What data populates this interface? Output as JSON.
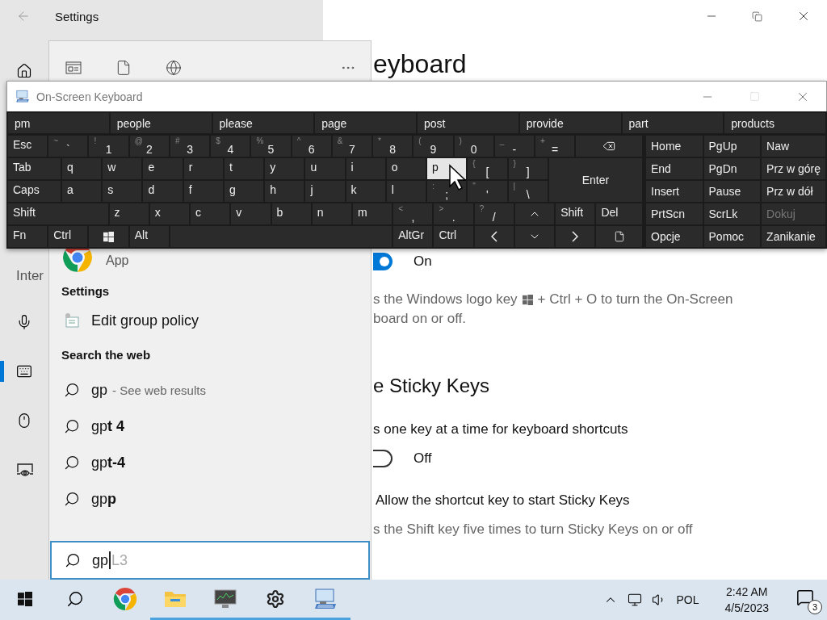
{
  "settings_window": {
    "title": "Settings",
    "nav_section": "Inter",
    "nav_items": [
      {
        "kind": "microphone",
        "selected": false
      },
      {
        "kind": "keyboard",
        "selected": true
      },
      {
        "kind": "mouse",
        "selected": false
      },
      {
        "kind": "eye",
        "selected": false
      }
    ],
    "heading": "eyboard",
    "osk_toggle": {
      "on": true,
      "label": "On"
    },
    "osk_hint": {
      "before": "s the Windows logo key",
      "after": "+ Ctrl + O to turn the On-Screen",
      "line2": "board on or off."
    },
    "sticky_heading": "e Sticky Keys",
    "sticky_desc": "s one key at a time for keyboard shortcuts",
    "sticky_toggle": {
      "on": false,
      "label": "Off"
    },
    "sticky_shortcut_label": "Allow the shortcut key to start Sticky Keys",
    "sticky_shortcut_hint": "s the Shift key five times to turn Sticky Keys on or off"
  },
  "search_panel": {
    "app_caption": "App",
    "settings_header": "Settings",
    "settings_items": [
      {
        "label": "Edit group policy"
      }
    ],
    "web_header": "Search the web",
    "web_results": [
      {
        "text": "gp",
        "suffix": "- See web results"
      },
      {
        "text": "gp**t 4**"
      },
      {
        "text": "gp**t-4**"
      },
      {
        "text": "gp**p**"
      }
    ],
    "query": {
      "value": "gp",
      "suggestion": "L3"
    }
  },
  "osk": {
    "title": "On-Screen Keyboard",
    "predictions": [
      "pm",
      "people",
      "please",
      "page",
      "post",
      "provide",
      "part",
      "products"
    ],
    "rows": [
      [
        {
          "kind": "text",
          "label": "Esc",
          "pressed": false
        },
        {
          "kind": "symbol",
          "label": "`",
          "shift": "~",
          "pressed": false
        },
        {
          "kind": "symbol",
          "label": "1",
          "shift": "!",
          "pressed": false
        },
        {
          "kind": "symbol",
          "label": "2",
          "shift": "@",
          "pressed": false
        },
        {
          "kind": "symbol",
          "label": "3",
          "shift": "#",
          "pressed": false
        },
        {
          "kind": "symbol",
          "label": "4",
          "shift": "$",
          "pressed": false
        },
        {
          "kind": "symbol",
          "label": "5",
          "shift": "%",
          "pressed": false
        },
        {
          "kind": "symbol",
          "label": "6",
          "shift": "^",
          "pressed": false
        },
        {
          "kind": "symbol",
          "label": "7",
          "shift": "&",
          "pressed": false
        },
        {
          "kind": "symbol",
          "label": "8",
          "shift": "*",
          "pressed": false
        },
        {
          "kind": "symbol",
          "label": "9",
          "shift": "(",
          "pressed": false
        },
        {
          "kind": "symbol",
          "label": "0",
          "shift": ")",
          "pressed": false
        },
        {
          "kind": "symbol",
          "label": "-",
          "shift": "_",
          "pressed": false
        },
        {
          "kind": "symbol",
          "label": "=",
          "shift": "+",
          "pressed": false
        },
        {
          "kind": "backspace",
          "pressed": false
        }
      ],
      [
        {
          "kind": "text",
          "label": "Tab",
          "pressed": false
        },
        {
          "kind": "text",
          "label": "q",
          "pressed": false
        },
        {
          "kind": "text",
          "label": "w",
          "pressed": false
        },
        {
          "kind": "text",
          "label": "e",
          "pressed": false
        },
        {
          "kind": "text",
          "label": "r",
          "pressed": false
        },
        {
          "kind": "text",
          "label": "t",
          "pressed": false
        },
        {
          "kind": "text",
          "label": "y",
          "pressed": false
        },
        {
          "kind": "text",
          "label": "u",
          "pressed": false
        },
        {
          "kind": "text",
          "label": "i",
          "pressed": false
        },
        {
          "kind": "text",
          "label": "o",
          "pressed": false
        },
        {
          "kind": "text",
          "label": "p",
          "pressed": true
        },
        {
          "kind": "symbol",
          "label": "[",
          "shift": "{",
          "pressed": false
        },
        {
          "kind": "symbol",
          "label": "]",
          "shift": "}",
          "pressed": false
        },
        {
          "kind": "enter",
          "label": "Enter",
          "pressed": false
        }
      ],
      [
        {
          "kind": "text",
          "label": "Caps",
          "pressed": false
        },
        {
          "kind": "text",
          "label": "a",
          "pressed": false
        },
        {
          "kind": "text",
          "label": "s",
          "pressed": false
        },
        {
          "kind": "text",
          "label": "d",
          "pressed": false
        },
        {
          "kind": "text",
          "label": "f",
          "pressed": false
        },
        {
          "kind": "text",
          "label": "g",
          "pressed": false
        },
        {
          "kind": "text",
          "label": "h",
          "pressed": false
        },
        {
          "kind": "text",
          "label": "j",
          "pressed": false
        },
        {
          "kind": "text",
          "label": "k",
          "pressed": false
        },
        {
          "kind": "text",
          "label": "l",
          "pressed": false
        },
        {
          "kind": "symbol",
          "label": ";",
          "shift": ":",
          "pressed": false
        },
        {
          "kind": "symbol",
          "label": "'",
          "shift": "\"",
          "pressed": false
        },
        {
          "kind": "symbol",
          "label": "\\",
          "shift": "|",
          "pressed": false
        }
      ],
      [
        {
          "kind": "text",
          "label": "Shift",
          "pressed": false
        },
        {
          "kind": "text",
          "label": "z",
          "pressed": false
        },
        {
          "kind": "text",
          "label": "x",
          "pressed": false
        },
        {
          "kind": "text",
          "label": "c",
          "pressed": false
        },
        {
          "kind": "text",
          "label": "v",
          "pressed": false
        },
        {
          "kind": "text",
          "label": "b",
          "pressed": false
        },
        {
          "kind": "text",
          "label": "n",
          "pressed": false
        },
        {
          "kind": "text",
          "label": "m",
          "pressed": false
        },
        {
          "kind": "symbol",
          "label": ",",
          "shift": "<",
          "pressed": false
        },
        {
          "kind": "symbol",
          "label": ".",
          "shift": ">",
          "pressed": false
        },
        {
          "kind": "symbol",
          "label": "/",
          "shift": "?",
          "pressed": false
        },
        {
          "kind": "up",
          "pressed": false
        },
        {
          "kind": "text",
          "label": "Shift",
          "pressed": false
        },
        {
          "kind": "text",
          "label": "Del",
          "pressed": false
        }
      ],
      [
        {
          "kind": "text",
          "label": "Fn",
          "pressed": false
        },
        {
          "kind": "text",
          "label": "Ctrl",
          "pressed": false
        },
        {
          "kind": "windows",
          "pressed": false
        },
        {
          "kind": "text",
          "label": "Alt",
          "pressed": false
        },
        {
          "kind": "space",
          "pressed": false
        },
        {
          "kind": "text",
          "label": "AltGr",
          "pressed": false
        },
        {
          "kind": "text",
          "label": "Ctrl",
          "pressed": false
        },
        {
          "kind": "left",
          "pressed": false
        },
        {
          "kind": "down",
          "pressed": false
        },
        {
          "kind": "right",
          "pressed": false
        },
        {
          "kind": "menu",
          "pressed": false
        }
      ]
    ],
    "nav_keys": [
      [
        {
          "label": "Home",
          "disabled": false
        },
        {
          "label": "PgUp",
          "disabled": false
        },
        {
          "label": "Naw",
          "disabled": false
        }
      ],
      [
        {
          "label": "End",
          "disabled": false
        },
        {
          "label": "PgDn",
          "disabled": false
        },
        {
          "label": "Prz w górę",
          "disabled": false
        }
      ],
      [
        {
          "label": "Insert",
          "disabled": false
        },
        {
          "label": "Pause",
          "disabled": false
        },
        {
          "label": "Prz w dół",
          "disabled": false
        }
      ],
      [
        {
          "label": "PrtScn",
          "disabled": false
        },
        {
          "label": "ScrLk",
          "disabled": false
        },
        {
          "label": "Dokuj",
          "disabled": true
        }
      ],
      [
        {
          "label": "Opcje",
          "disabled": false
        },
        {
          "label": "Pomoc",
          "disabled": false
        },
        {
          "label": "Zanikanie",
          "disabled": false
        }
      ]
    ]
  },
  "taskbar": {
    "apps": [
      {
        "kind": "chrome",
        "running": false
      },
      {
        "kind": "folder",
        "running": true
      },
      {
        "kind": "monitor",
        "running": true
      },
      {
        "kind": "gear",
        "running": true
      },
      {
        "kind": "osk",
        "running": true
      }
    ],
    "language": "POL",
    "time": "2:42 AM",
    "date": "4/5/2023",
    "notification_count": "3"
  }
}
